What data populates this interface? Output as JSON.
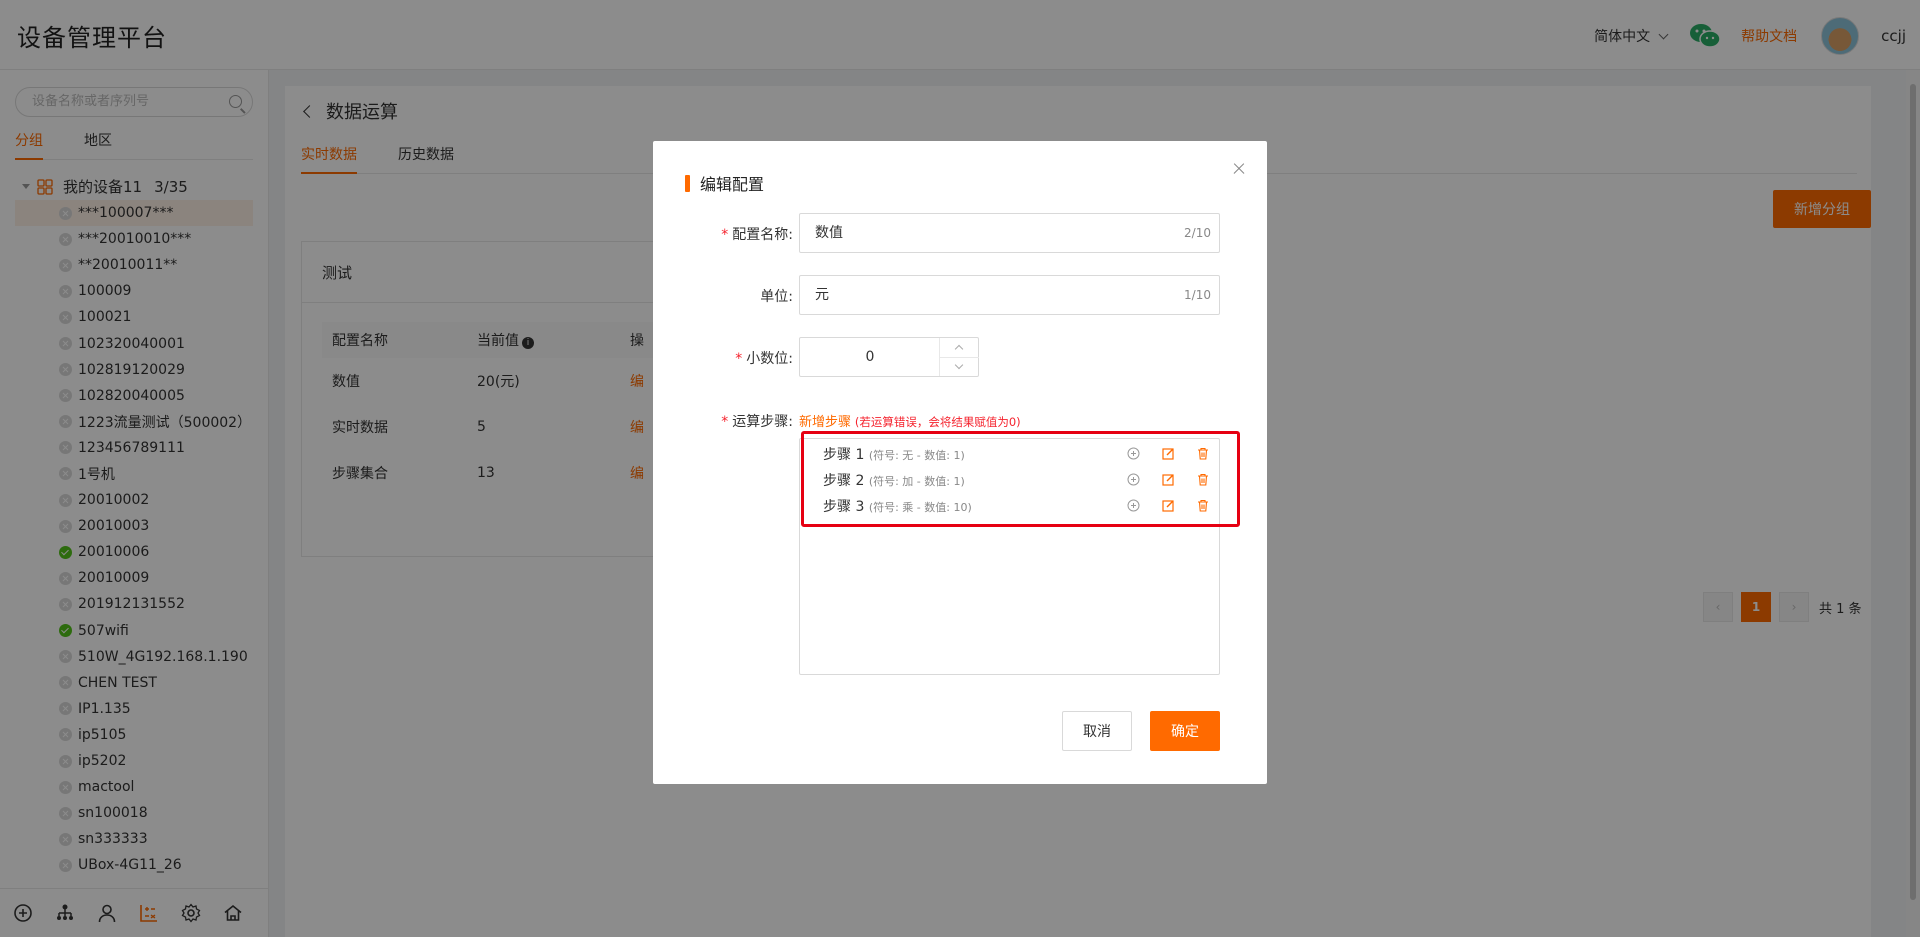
{
  "header": {
    "app_title": "设备管理平台",
    "language": "简体中文",
    "help_link": "帮助文档",
    "username": "ccjj"
  },
  "sidebar": {
    "search_placeholder": "设备名称或者序列号",
    "tabs": [
      "分组",
      "地区"
    ],
    "group_name": "我的设备11",
    "group_count": "3/35",
    "devices": [
      {
        "name": "***100007***",
        "status": "offline",
        "selected": true
      },
      {
        "name": "***20010010***",
        "status": "offline"
      },
      {
        "name": "**20010011**",
        "status": "offline"
      },
      {
        "name": "100009",
        "status": "offline"
      },
      {
        "name": "100021",
        "status": "offline"
      },
      {
        "name": "102320040001",
        "status": "offline"
      },
      {
        "name": "102819120029",
        "status": "offline"
      },
      {
        "name": "102820040005",
        "status": "offline"
      },
      {
        "name": "1223流量测试（500002）",
        "status": "offline"
      },
      {
        "name": "123456789111",
        "status": "offline"
      },
      {
        "name": "1号机",
        "status": "offline"
      },
      {
        "name": "20010002",
        "status": "offline"
      },
      {
        "name": "20010003",
        "status": "offline"
      },
      {
        "name": "20010006",
        "status": "online"
      },
      {
        "name": "20010009",
        "status": "offline"
      },
      {
        "name": "201912131552",
        "status": "offline"
      },
      {
        "name": "507wifi",
        "status": "online"
      },
      {
        "name": "510W_4G192.168.1.190",
        "status": "offline"
      },
      {
        "name": "CHEN TEST",
        "status": "offline"
      },
      {
        "name": "IP1.135",
        "status": "offline"
      },
      {
        "name": "ip5105",
        "status": "offline"
      },
      {
        "name": "ip5202",
        "status": "offline"
      },
      {
        "name": "mactool",
        "status": "offline"
      },
      {
        "name": "sn100018",
        "status": "offline"
      },
      {
        "name": "sn333333",
        "status": "offline"
      },
      {
        "name": "UBox-4G11_26",
        "status": "offline"
      }
    ]
  },
  "main": {
    "page_title": "数据运算",
    "tabs": [
      "实时数据",
      "历史数据"
    ],
    "add_group_button": "新增分组",
    "group_title": "测试",
    "table": {
      "columns": [
        "配置名称",
        "当前值",
        "操"
      ],
      "rows": [
        {
          "name": "数值",
          "value": "20(元)",
          "action": "编"
        },
        {
          "name": "实时数据",
          "value": "5",
          "action": "编"
        },
        {
          "name": "步骤集合",
          "value": "13",
          "action": "编"
        }
      ]
    },
    "pagination": {
      "current": "1",
      "total": "共 1 条",
      "prev": "‹",
      "next": "›"
    }
  },
  "modal": {
    "title": "编辑配置",
    "fields": {
      "config_name_label": "配置名称:",
      "config_name_value": "数值",
      "config_name_count": "2/10",
      "unit_label": "单位:",
      "unit_value": "元",
      "unit_count": "1/10",
      "decimal_label": "小数位:",
      "decimal_value": "0",
      "steps_label": "运算步骤:"
    },
    "steps_add": "新增步骤",
    "steps_note": "(若运算错误，会将结果赋值为0)",
    "steps": [
      {
        "label": "步骤 1",
        "detail": "(符号: 无 - 数值: 1)"
      },
      {
        "label": "步骤 2",
        "detail": "(符号: 加 - 数值: 1)"
      },
      {
        "label": "步骤 3",
        "detail": "(符号: 乘 - 数值: 10)"
      }
    ],
    "cancel_button": "取消",
    "confirm_button": "确定"
  },
  "colors": {
    "accent": "#ff6a00",
    "danger": "#e60012",
    "online": "#52c41a",
    "offline": "#d9d9d9"
  }
}
